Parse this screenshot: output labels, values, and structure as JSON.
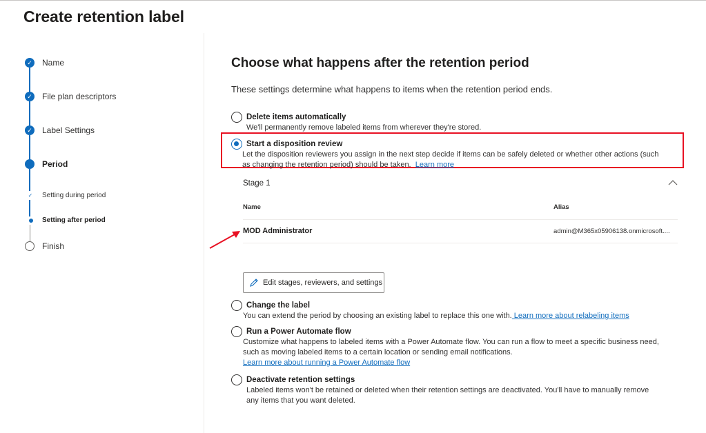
{
  "page": {
    "title": "Create retention label"
  },
  "sidebar": {
    "steps": [
      {
        "label": "Name",
        "state": "complete"
      },
      {
        "label": "File plan descriptors",
        "state": "complete"
      },
      {
        "label": "Label Settings",
        "state": "complete"
      },
      {
        "label": "Period",
        "state": "current"
      },
      {
        "label": "Setting during period",
        "state": "complete-sub"
      },
      {
        "label": "Setting after period",
        "state": "current-sub"
      },
      {
        "label": "Finish",
        "state": "pending"
      }
    ]
  },
  "main": {
    "title": "Choose what happens after the retention period",
    "intro": "These settings determine what happens to items when the retention period ends.",
    "options": [
      {
        "title": "Delete items automatically",
        "desc": "We'll permanently remove labeled items from wherever they're stored.",
        "selected": false
      },
      {
        "title": "Start a disposition review",
        "desc_line1": "Let the disposition reviewers you assign in the next step decide if items can be safely deleted or whether other actions (such",
        "desc_line2": "as changing the retention period) should be taken.",
        "link": "Learn more",
        "selected": true
      },
      {
        "title": "Change the label",
        "desc": "You can extend the period by choosing an existing label to replace this one with.",
        "link": " Learn more about relabeling items",
        "selected": false
      },
      {
        "title": "Run a Power Automate flow",
        "desc_line1": "Customize what happens to labeled items with a Power Automate flow. You can run a flow to meet a specific business need,",
        "desc_line2": "such as moving labeled items to a certain location or sending email notifications.",
        "link": "Learn more about running a Power Automate flow",
        "selected": false
      },
      {
        "title": "Deactivate retention settings",
        "desc_line1": "Labeled items won't be retained or deleted when their retention settings are deactivated. You'll have to manually remove",
        "desc_line2": "any items that you want deleted.",
        "selected": false
      }
    ],
    "stage": {
      "label": "Stage 1",
      "col_name": "Name",
      "col_alias": "Alias",
      "rows": [
        {
          "name": "MOD Administrator",
          "alias": "admin@M365x05906138.onmicrosoft...."
        }
      ],
      "edit_button": "Edit stages, reviewers, and settings"
    }
  },
  "colors": {
    "accent": "#0f6cbd",
    "highlight": "#e81123"
  },
  "icons": [
    "check-icon",
    "chevron-up-icon",
    "pencil-icon",
    "red-arrow-icon"
  ]
}
